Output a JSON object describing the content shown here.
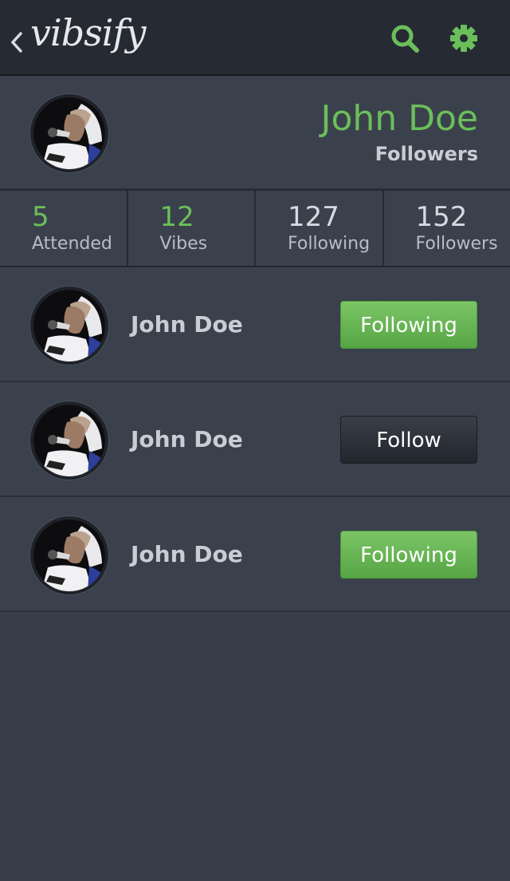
{
  "app": {
    "logo_text": "vibsify"
  },
  "header": {
    "icons": {
      "back": "chevron-left-icon",
      "search": "search-icon",
      "settings": "gear-icon"
    },
    "accent_color": "#6bbf5a"
  },
  "profile": {
    "name": "John Doe",
    "subtitle": "Followers"
  },
  "stats": [
    {
      "value": "5",
      "label": "Attended"
    },
    {
      "value": "12",
      "label": "Vibes"
    },
    {
      "value": "127",
      "label": "Following"
    },
    {
      "value": "152",
      "label": "Followers"
    }
  ],
  "users": [
    {
      "name": "John Doe",
      "button_label": "Following",
      "state": "following"
    },
    {
      "name": "John Doe",
      "button_label": "Follow",
      "state": "follow"
    },
    {
      "name": "John Doe",
      "button_label": "Following",
      "state": "following"
    }
  ]
}
